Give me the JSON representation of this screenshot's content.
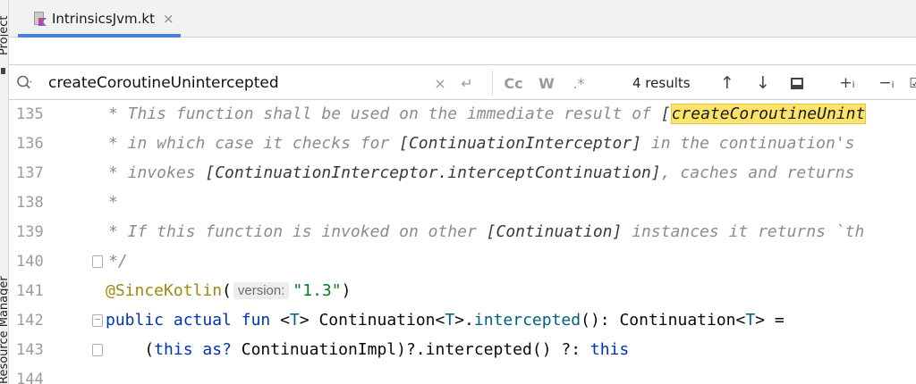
{
  "tool_strip": {
    "project_label": "Project",
    "manager_label": "Resource Manager"
  },
  "tab": {
    "filename": "IntrinsicsJvm.kt",
    "close": "×"
  },
  "search": {
    "query": "createCoroutineUnintercepted",
    "clear": "×",
    "newline": "↵",
    "match_case": "Cc",
    "words": "W",
    "regex": ".*",
    "results": "4 results",
    "prev": "↑",
    "next": "↓",
    "add_occ": "+ᵢ",
    "remove_occ": "−ᵢ",
    "select_all": "☑"
  },
  "lines": [
    {
      "num": "135",
      "parts": [
        "* This function shall be used on the immediate result of ",
        "[",
        "createCoroutineUnint"
      ]
    },
    {
      "num": "136",
      "parts": [
        "* in which case it checks for ",
        "[ContinuationInterceptor]",
        " in the continuation's"
      ]
    },
    {
      "num": "137",
      "parts": [
        "* invokes ",
        "[ContinuationInterceptor.interceptContinuation]",
        ", caches and returns"
      ]
    },
    {
      "num": "138",
      "parts": [
        "*"
      ]
    },
    {
      "num": "139",
      "parts": [
        "* If this function is invoked on other ",
        "[Continuation]",
        " instances it returns `th"
      ]
    },
    {
      "num": "140",
      "parts": [
        "*/"
      ]
    },
    {
      "num": "141",
      "parts": [
        "@SinceKotlin",
        "(",
        "version:",
        "\"1.3\"",
        ")"
      ]
    },
    {
      "num": "142",
      "parts": [
        "public",
        " ",
        "actual",
        " ",
        "fun",
        " <",
        "T",
        "> Continuation<",
        "T",
        ">.",
        "intercepted",
        "(): Continuation<",
        "T",
        "> ="
      ]
    },
    {
      "num": "143",
      "parts": [
        "    (",
        "this",
        " ",
        "as?",
        " ContinuationImpl)?.intercepted() ?: ",
        "this"
      ]
    },
    {
      "num": "144",
      "parts": [
        ""
      ]
    }
  ]
}
